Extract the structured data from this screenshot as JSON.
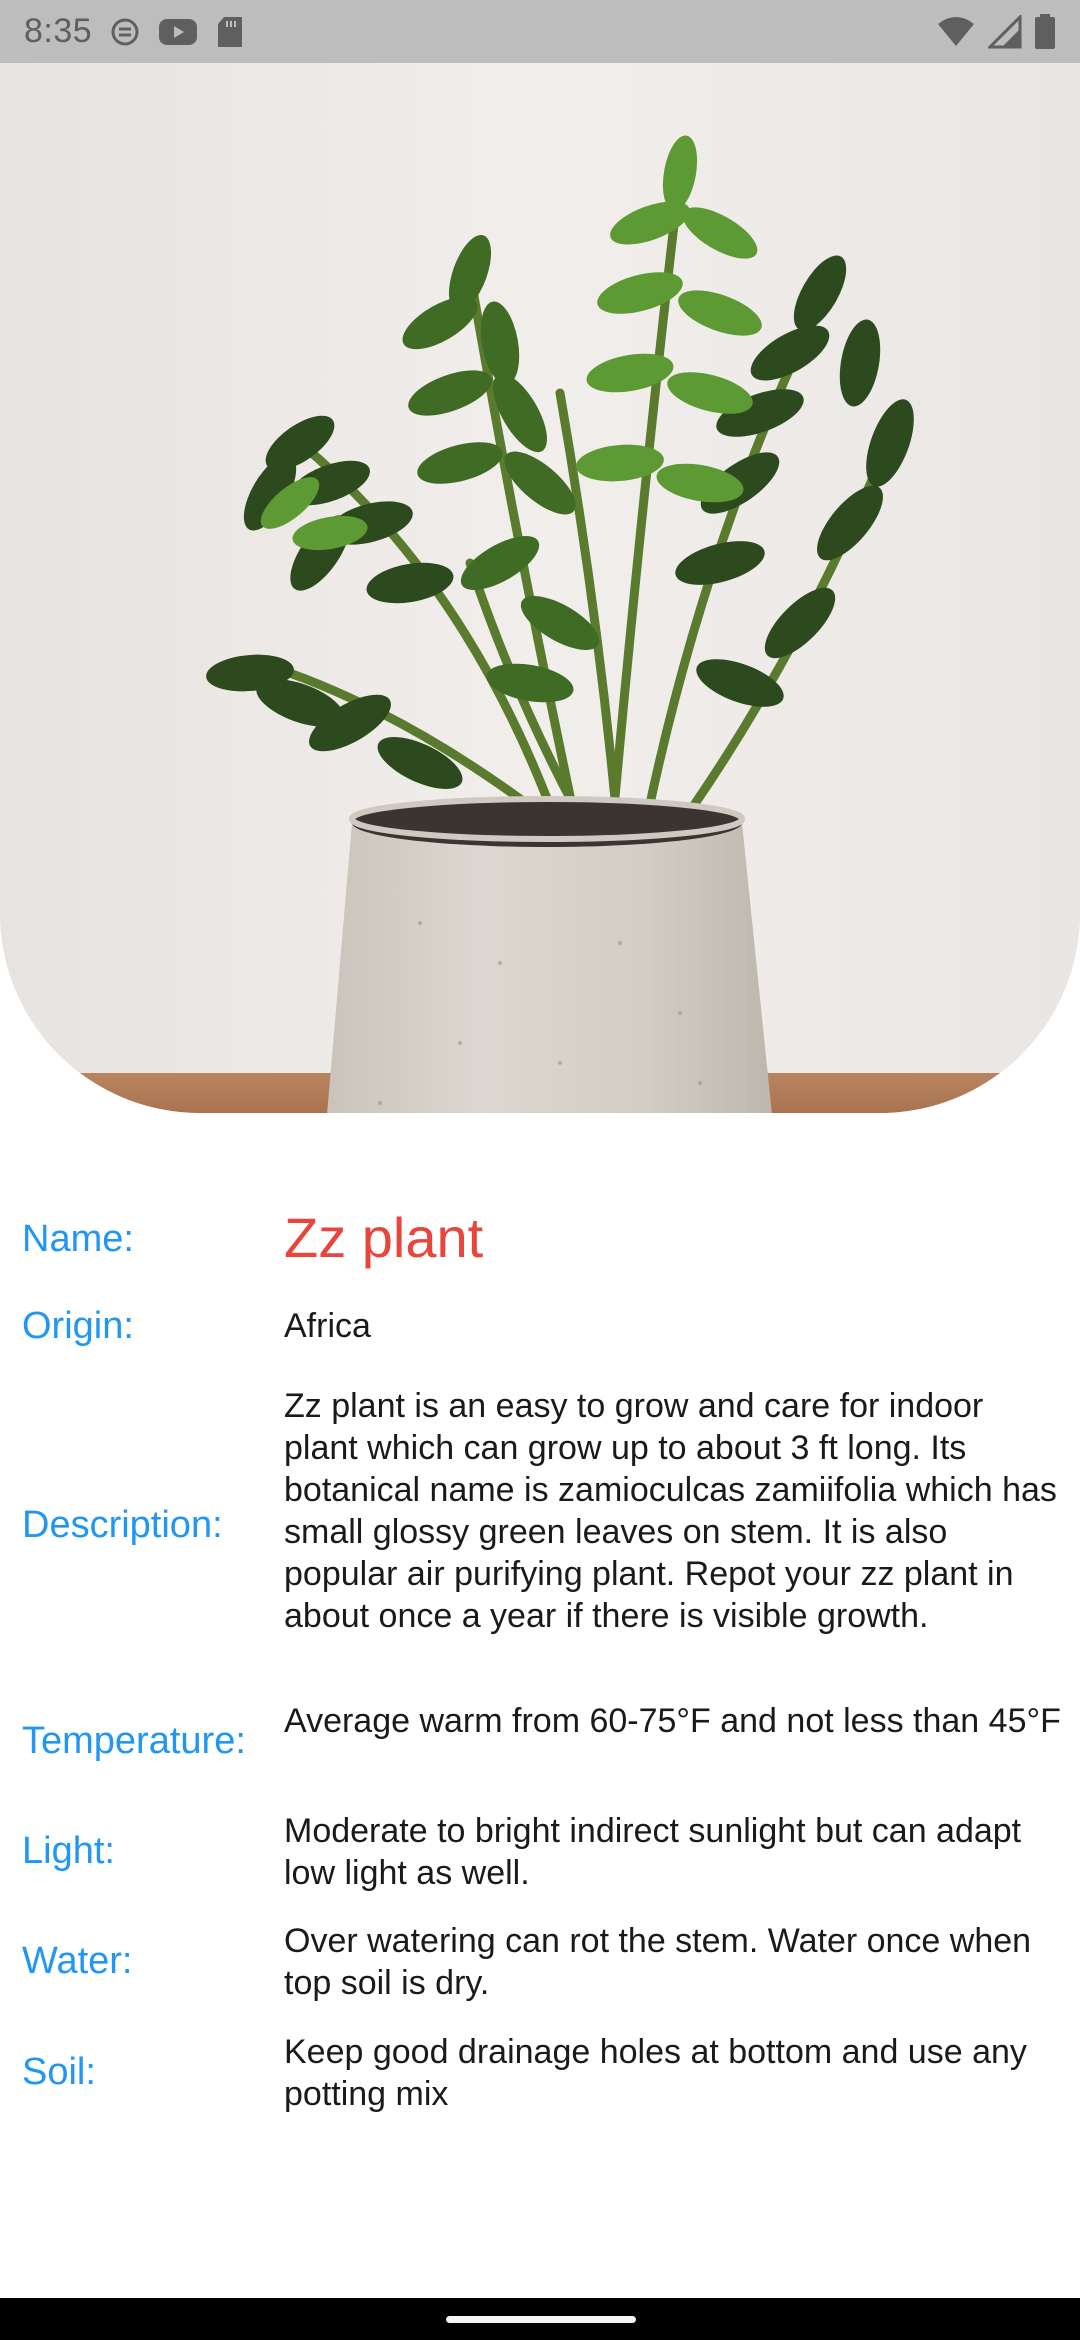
{
  "status_bar": {
    "time": "8:35",
    "left_icons": [
      "data-saver-icon",
      "youtube-icon",
      "sd-card-icon"
    ],
    "right_icons": [
      "wifi-icon",
      "cell-signal-icon",
      "battery-icon"
    ]
  },
  "hero": {
    "image_subject": "zz-plant-photo"
  },
  "colors": {
    "label": "#2196f3",
    "name": "#e8453c",
    "text": "#1a1a1a",
    "status_bar": "#bdbdbd"
  },
  "plant": {
    "name_label": "Name:",
    "name": "Zz plant",
    "origin_label": "Origin:",
    "origin": "Africa",
    "description_label": "Description:",
    "description": "Zz plant is an easy to grow and care for indoor plant which can grow up to about 3 ft long. Its botanical name is zamioculcas zamiifolia which has small glossy green leaves on stem. It is also popular air purifying plant. Repot your zz plant in about once a year if there is visible growth.",
    "temperature_label": "Temperature:",
    "temperature": "Average warm from 60-75°F and not less than 45°F",
    "light_label": "Light:",
    "light": "Moderate to bright indirect sunlight but can adapt low light as well.",
    "water_label": "Water:",
    "water": "Over watering can rot the stem. Water once when top soil is dry.",
    "soil_label": "Soil:",
    "soil": "Keep good drainage holes at bottom and use any potting mix"
  }
}
